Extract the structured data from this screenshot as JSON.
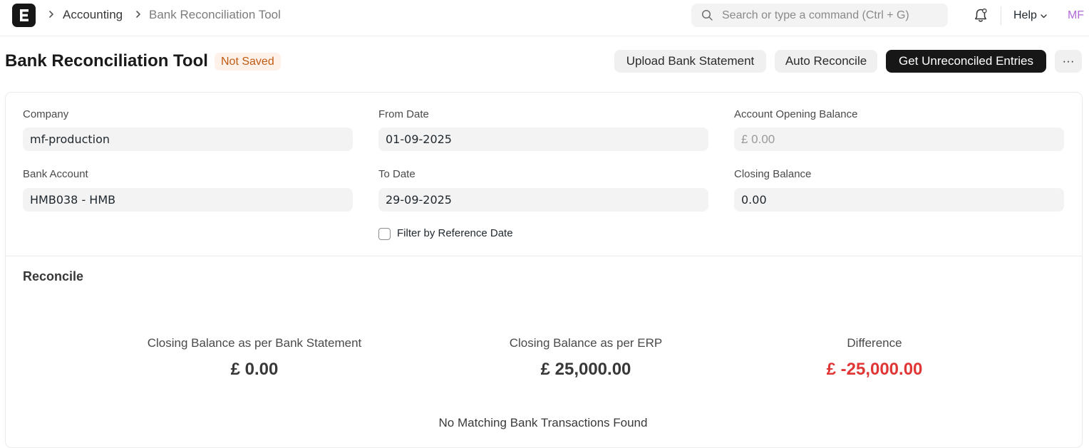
{
  "navbar": {
    "logo_letter": "E",
    "breadcrumbs": [
      "Accounting",
      "Bank Reconciliation Tool"
    ],
    "search_placeholder": "Search or type a command (Ctrl + G)",
    "help_label": "Help",
    "avatar_initials": "MF"
  },
  "page": {
    "title": "Bank Reconciliation Tool",
    "status": "Not Saved",
    "actions": {
      "upload": "Upload Bank Statement",
      "auto_reconcile": "Auto Reconcile",
      "get_entries": "Get Unreconciled Entries",
      "more": "···"
    }
  },
  "form": {
    "company": {
      "label": "Company",
      "value": "mf-production"
    },
    "bank_account": {
      "label": "Bank Account",
      "value": "HMB038 - HMB"
    },
    "from_date": {
      "label": "From Date",
      "value": "01-09-2025"
    },
    "to_date": {
      "label": "To Date",
      "value": "29-09-2025"
    },
    "opening_balance": {
      "label": "Account Opening Balance",
      "value": "£ 0.00"
    },
    "closing_balance": {
      "label": "Closing Balance",
      "value": "0.00"
    },
    "filter_by_reference_date": {
      "label": "Filter by Reference Date",
      "checked": false
    }
  },
  "reconcile": {
    "title": "Reconcile",
    "summary": {
      "bank_statement": {
        "label": "Closing Balance as per Bank Statement",
        "value": "£ 0.00"
      },
      "erp": {
        "label": "Closing Balance as per ERP",
        "value": "£ 25,000.00"
      },
      "difference": {
        "label": "Difference",
        "value": "£ -25,000.00"
      }
    },
    "empty_message": "No Matching Bank Transactions Found"
  },
  "colors": {
    "primary_button": "#171717",
    "negative_amount": "#e03636",
    "status_badge_bg": "#fdf1e9",
    "status_badge_text": "#c05b14",
    "avatar_text": "#b06ad6"
  },
  "icons": [
    "app-logo-icon",
    "chevron-right-icon",
    "search-icon",
    "bell-icon",
    "chevron-down-icon"
  ]
}
